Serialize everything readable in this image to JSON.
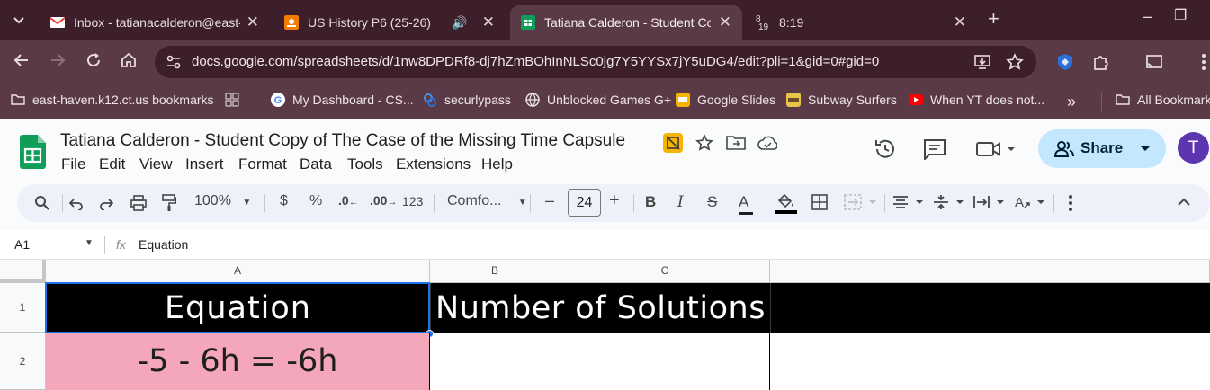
{
  "browser": {
    "tabs": [
      {
        "title": "Inbox - tatianacalderon@east-h",
        "favicon": "gmail-icon"
      },
      {
        "title": "US History P6 (25-26)",
        "favicon": "classroom-icon"
      },
      {
        "title": "Tatiana Calderon - Student Copy",
        "favicon": "sheets-icon"
      },
      {
        "title": "8:19",
        "favicon": "calendar-icon",
        "badge_top": "8",
        "badge_bottom": "19"
      }
    ],
    "url": "docs.google.com/spreadsheets/d/1nw8DPDRf8-dj7hZmBOhInNLSc0jg7Y5YYSx7jY5uDG4/edit?pli=1&gid=0#gid=0",
    "bookmarks": [
      "east-haven.k12.ct.us bookmarks",
      "My Dashboard - CS...",
      "securlypass",
      "Unblocked Games G+",
      "Google Slides",
      "Subway Surfers",
      "When YT does not...",
      "All Bookmarks"
    ]
  },
  "sheets": {
    "title": "Tatiana Calderon - Student Copy of The Case of the Missing Time Capsule",
    "menu": [
      "File",
      "Edit",
      "View",
      "Insert",
      "Format",
      "Data",
      "Tools",
      "Extensions",
      "Help"
    ],
    "share_label": "Share",
    "avatar_letter": "T",
    "toolbar": {
      "zoom": "100%",
      "currency": "$",
      "percent": "%",
      "dec_decrease": ".0",
      "dec_increase": ".00",
      "number_format": "123",
      "font": "Comfo...",
      "font_size": "24",
      "minus": "–",
      "plus": "+",
      "bold": "B",
      "italic": "I",
      "strike": "S",
      "text_color": "A"
    },
    "namebox": "A1",
    "fx": "fx",
    "formula": "Equation",
    "columns": [
      "A",
      "B",
      "C"
    ],
    "rows": [
      "1",
      "2"
    ],
    "cells": {
      "a1": "Equation",
      "bc1": "Number of Solutions",
      "a2": "-5 - 6h = -6h"
    },
    "colors": {
      "header_bg": "#000000",
      "header_text": "#ffffff",
      "row2_bg": "#f4a7bb",
      "selection": "#1a73e8"
    }
  }
}
